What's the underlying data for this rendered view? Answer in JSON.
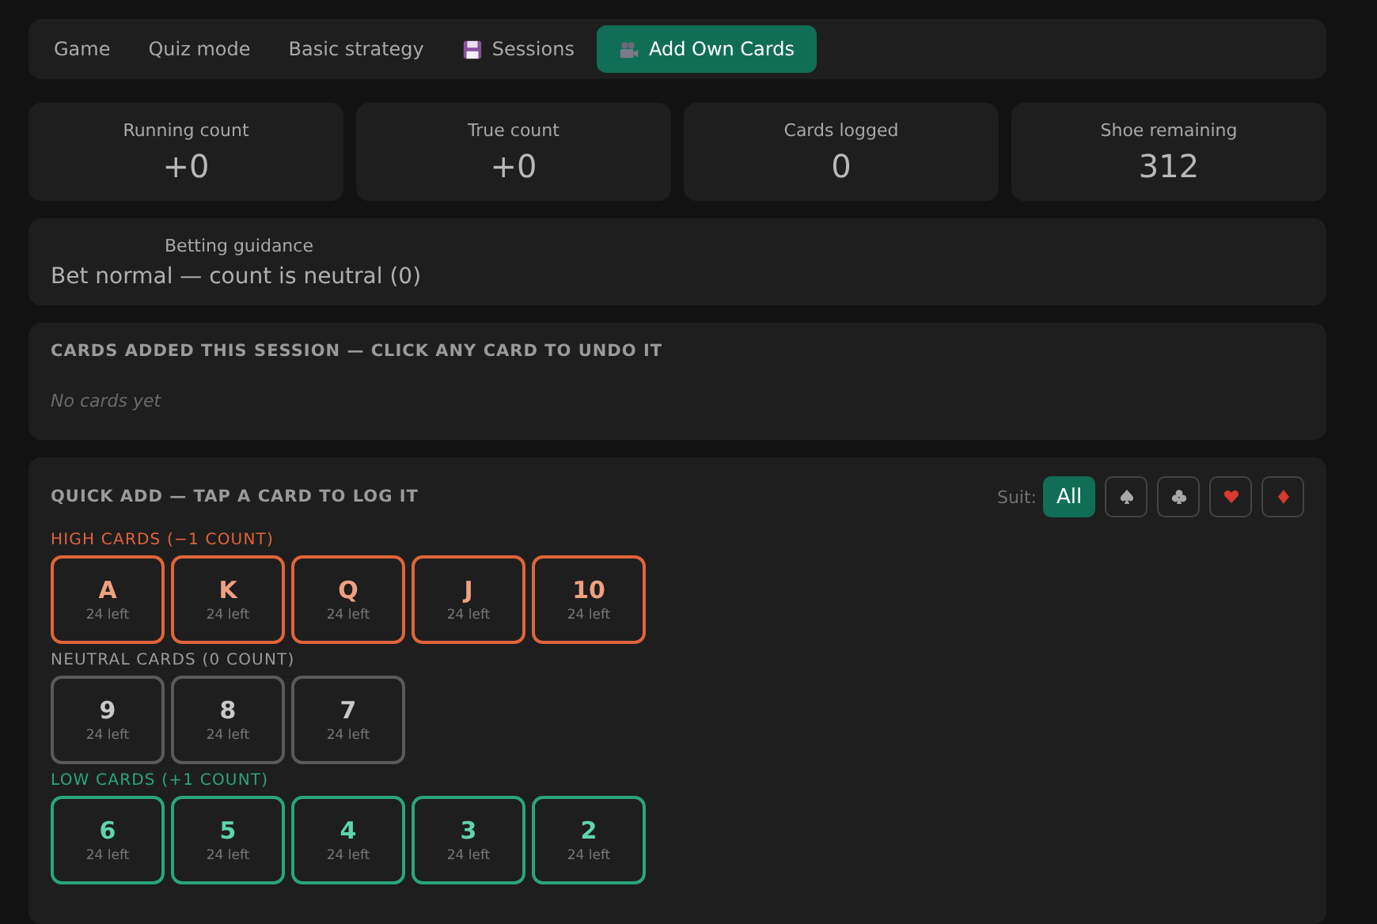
{
  "tabs": [
    {
      "label": "Game",
      "kind": "plain",
      "selected": false
    },
    {
      "label": "Quiz mode",
      "kind": "plain",
      "selected": false
    },
    {
      "label": "Basic strategy",
      "kind": "plain",
      "selected": false
    },
    {
      "label": "Sessions",
      "kind": "disk",
      "selected": false
    },
    {
      "label": "Add Own Cards",
      "kind": "camera",
      "selected": true
    }
  ],
  "stats": [
    {
      "label": "Running count",
      "value": "+0"
    },
    {
      "label": "True count",
      "value": "+0"
    },
    {
      "label": "Cards logged",
      "value": "0"
    },
    {
      "label": "Shoe remaining",
      "value": "312"
    }
  ],
  "guidance": {
    "label": "Betting guidance",
    "text": "Bet normal — count is neutral (0)"
  },
  "session": {
    "title": "CARDS ADDED THIS SESSION — CLICK ANY CARD TO UNDO IT",
    "empty": "No cards yet"
  },
  "quick_add": {
    "title": "QUICK ADD — TAP A CARD TO LOG IT",
    "suit_label": "Suit:",
    "suits": [
      {
        "kind": "all",
        "label": "All",
        "selected": true
      },
      {
        "kind": "spade",
        "selected": false
      },
      {
        "kind": "club",
        "selected": false
      },
      {
        "kind": "heart",
        "selected": false
      },
      {
        "kind": "diamond",
        "selected": false
      }
    ],
    "groups": [
      {
        "title": "HIGH CARDS (−1 COUNT)",
        "color": "#e0643a",
        "cards": [
          {
            "rank": "A",
            "left": "24 left"
          },
          {
            "rank": "K",
            "left": "24 left"
          },
          {
            "rank": "Q",
            "left": "24 left"
          },
          {
            "rank": "J",
            "left": "24 left"
          },
          {
            "rank": "10",
            "left": "24 left"
          }
        ]
      },
      {
        "title": "NEUTRAL CARDS (0 COUNT)",
        "color": "#5a5a5a",
        "cards": [
          {
            "rank": "9",
            "left": "24 left"
          },
          {
            "rank": "8",
            "left": "24 left"
          },
          {
            "rank": "7",
            "left": "24 left"
          }
        ]
      },
      {
        "title": "LOW CARDS (+1 COUNT)",
        "color": "#2aa57d",
        "cards": [
          {
            "rank": "6",
            "left": "24 left"
          },
          {
            "rank": "5",
            "left": "24 left"
          },
          {
            "rank": "4",
            "left": "24 left"
          },
          {
            "rank": "3",
            "left": "24 left"
          },
          {
            "rank": "2",
            "left": "24 left"
          }
        ]
      }
    ]
  }
}
